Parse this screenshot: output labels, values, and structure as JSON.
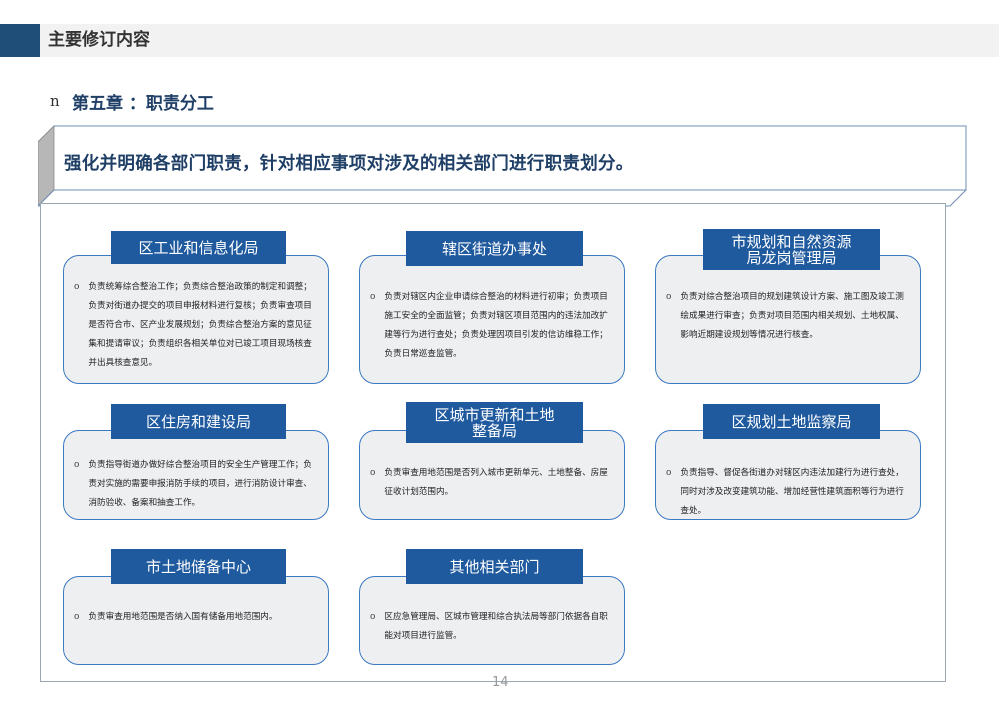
{
  "header": {
    "title": "主要修订内容"
  },
  "chapter": {
    "bullet": "n",
    "title": "第五章 ：职责分工"
  },
  "banner": {
    "text": "强化并明确各部门职责，针对相应事项对涉及的相关部门进行职责划分。"
  },
  "bullet_symbol": "ο",
  "cards": [
    {
      "title": "区工业和信息化局",
      "text": "负责统筹综合整治工作；负责综合整治政策的制定和调整；负责对街道办提交的项目申报材料进行复核；负责审查项目是否符合市、区产业发展规划；负责综合整治方案的意见征集和提请审议；负责组织各相关单位对已竣工项目现场核查并出具核查意见。"
    },
    {
      "title": "辖区街道办事处",
      "text": "负责对辖区内企业申请综合整治的材料进行初审；负责项目施工安全的全面监管；负责对辖区项目范围内的违法加改扩建等行为进行查处；负责处理因项目引发的信访维稳工作；负责日常巡查监管。"
    },
    {
      "title": "市规划和自然资源局龙岗管理局",
      "text": "负责对综合整治项目的规划建筑设计方案、施工图及竣工测绘成果进行审查；负责对项目范围内相关规划、土地权属、影响近期建设规划等情况进行核查。"
    },
    {
      "title": "区住房和建设局",
      "text": "负责指导街道办做好综合整治项目的安全生产管理工作；负责对实施的需要申报消防手续的项目，进行消防设计审查、消防验收、备案和抽查工作。"
    },
    {
      "title": "区城市更新和土地整备局",
      "text": "负责审查用地范围是否列入城市更新单元、土地整备、房屋征收计划范围内。"
    },
    {
      "title": "区规划土地监察局",
      "text": "负责指导、督促各街道办对辖区内违法加建行为进行查处，同时对涉及改变建筑功能、增加经营性建筑面积等行为进行查处。"
    },
    {
      "title": "市土地储备中心",
      "text": "负责审查用地范围是否纳入国有储备用地范围内。"
    },
    {
      "title": "其他相关部门",
      "text": "区应急管理局、区城市管理和综合执法局等部门依据各自职能对项目进行监管。"
    }
  ],
  "page_number": "14"
}
